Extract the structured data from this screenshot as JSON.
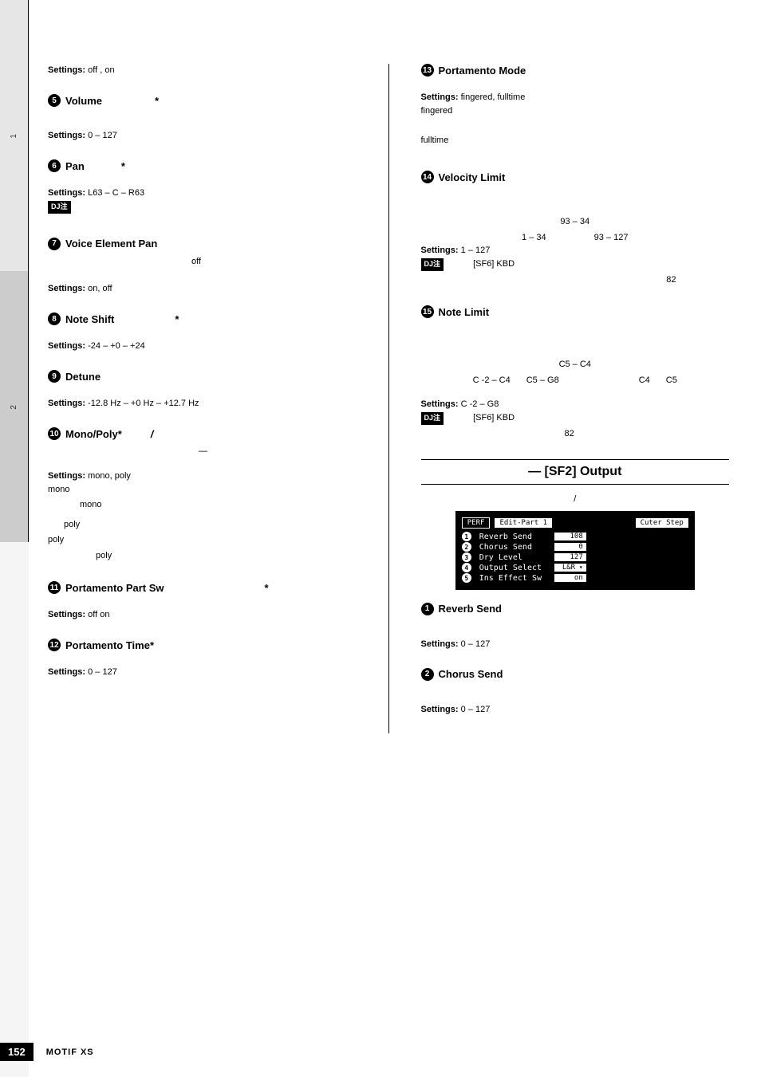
{
  "sidebar": {
    "tab1": "1",
    "tab2": "2"
  },
  "footer": {
    "page": "152",
    "product": "MOTIF XS"
  },
  "left": {
    "p_off_on": {
      "settings_label": "Settings:",
      "settings_val": "off          , on"
    },
    "p5": {
      "num": "5",
      "title": "Volume",
      "star": "*",
      "settings_label": "Settings:",
      "settings_val": "0 – 127"
    },
    "p6": {
      "num": "6",
      "title": "Pan",
      "star": "*",
      "settings_label": "Settings:",
      "settings_val": "L63          – C          – R63",
      "note_icon": "DJ注"
    },
    "p7": {
      "num": "7",
      "title": "Voice Element Pan",
      "desc_off": "off",
      "settings_label": "Settings:",
      "settings_val": "on, off"
    },
    "p8": {
      "num": "8",
      "title": "Note Shift",
      "star": "*",
      "settings_label": "Settings:",
      "settings_val": "-24 – +0 – +24"
    },
    "p9": {
      "num": "9",
      "title": "Detune",
      "settings_label": "Settings:",
      "settings_val": "-12.8 Hz – +0 Hz – +12.7 Hz"
    },
    "p10": {
      "num": "10",
      "title": "Mono/Poly*",
      "slash": "/",
      "dash": "—",
      "settings_label": "Settings:",
      "settings_val": "mono, poly",
      "mono1": "mono",
      "mono2": "mono",
      "poly1": "poly",
      "poly2": "poly",
      "poly3": "poly"
    },
    "p11": {
      "num": "11",
      "title": "Portamento Part Sw",
      "star": "*",
      "settings_label": "Settings:",
      "settings_val": "off   on"
    },
    "p12": {
      "num": "12",
      "title": "Portamento Time*",
      "settings_label": "Settings:",
      "settings_val": "0 – 127"
    }
  },
  "right": {
    "p13": {
      "num": "13",
      "title": "Portamento Mode",
      "settings_label": "Settings:",
      "settings_val": "fingered, fulltime",
      "fingered": "fingered",
      "fulltime": "fulltime"
    },
    "p14": {
      "num": "14",
      "title": "Velocity Limit",
      "line1": "93 – 34",
      "line2a": "1 – 34",
      "line2b": "93 – 127",
      "settings_label": "Settings:",
      "settings_val": "1 – 127",
      "note_icon": "DJ注",
      "note_txt": "[SF6] KBD",
      "note_pg": "82"
    },
    "p15": {
      "num": "15",
      "title": "Note Limit",
      "line1": "C5 – C4",
      "line2a": "C -2 – C4",
      "line2b": "C5 – G8",
      "line2c": "C4",
      "line2d": "C5",
      "settings_label": "Settings:",
      "settings_val": "C -2 – G8",
      "note_icon": "DJ注",
      "note_txt": "[SF6] KBD",
      "note_pg": "82"
    },
    "section_output": "— [SF2] Output",
    "section_sub": "/",
    "lcd": {
      "top_left": "PERF",
      "top_mid": "Edit-Part 1",
      "top_right": "Cuter Step",
      "rows": [
        {
          "n": "1",
          "label": "Reverb Send",
          "val": "108"
        },
        {
          "n": "2",
          "label": "Chorus Send",
          "val": "0"
        },
        {
          "n": "3",
          "label": "Dry Level",
          "val": "127"
        },
        {
          "n": "4",
          "label": "Output Select",
          "val": "L&R",
          "dd": true
        },
        {
          "n": "5",
          "label": "Ins Effect Sw",
          "val": "on"
        }
      ]
    },
    "o1": {
      "num": "1",
      "title": "Reverb Send",
      "settings_label": "Settings:",
      "settings_val": "0 – 127"
    },
    "o2": {
      "num": "2",
      "title": "Chorus Send",
      "settings_label": "Settings:",
      "settings_val": "0 – 127"
    }
  }
}
